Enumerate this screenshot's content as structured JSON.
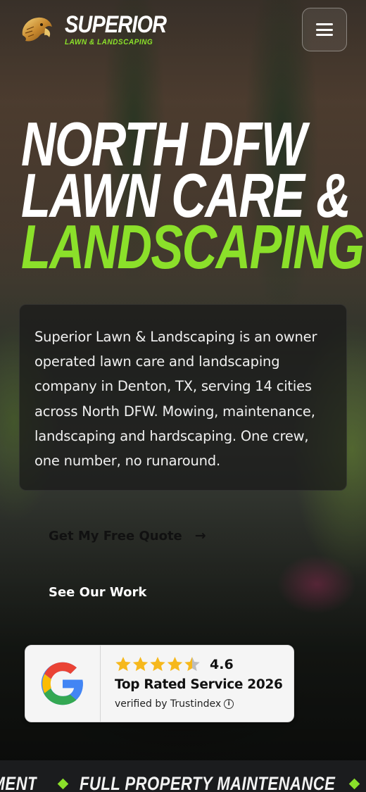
{
  "header": {
    "logo_icon": "eagle-head-icon",
    "brand_name": "SUPERIOR",
    "brand_tagline": "LAWN & LANDSCAPING",
    "menu_icon": "hamburger-menu-icon"
  },
  "hero": {
    "title_line1": "NORTH DFW",
    "title_line2": "LAWN CARE &",
    "title_line3": "LANDSCAPING",
    "description": "Superior Lawn & Landscaping is an owner operated lawn care and landscaping company in Denton, TX, serving 14 cities across North DFW. Mowing, maintenance, landscaping and hardscaping. One crew, one number, no runaround."
  },
  "buttons": {
    "quote_label": "Get My Free Quote",
    "quote_icon": "arrow-right-icon",
    "work_label": "See Our Work"
  },
  "review": {
    "provider_icon": "google-g-icon",
    "stars": 4.5,
    "rating": "4.6",
    "title": "Top Rated Service 2026",
    "verified": "verified by Trustindex",
    "info_icon": "info-icon"
  },
  "marquee": {
    "items": [
      "TMENT",
      "FULL PROPERTY MAINTENANCE"
    ]
  },
  "colors": {
    "accent": "#8be02a",
    "star": "#f6b81c",
    "button_text_dark": "#111111"
  }
}
